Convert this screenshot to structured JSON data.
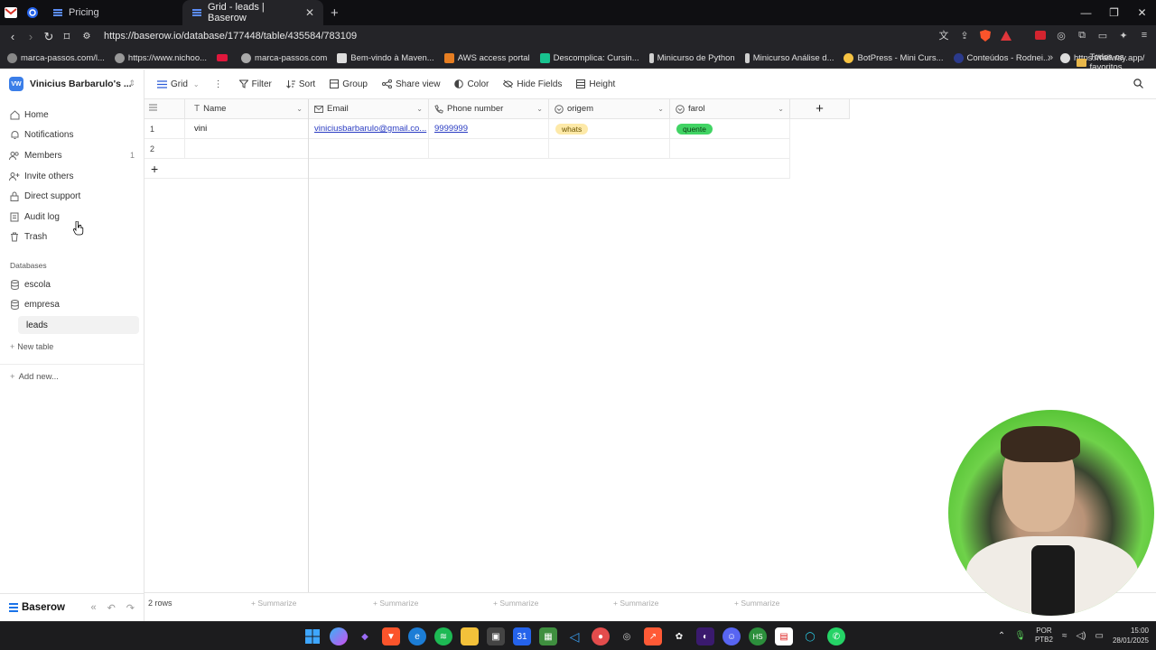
{
  "browser": {
    "tabs": [
      {
        "label": "Pricing"
      },
      {
        "label": "Grid - leads | Baserow"
      }
    ],
    "url": "https://baserow.io/database/177448/table/435584/783109",
    "bookmarks": [
      {
        "label": "marca-passos.com/l...",
        "color": "#888"
      },
      {
        "label": "https://www.nichoo...",
        "color": "#999"
      },
      {
        "label": "",
        "color": "#e0173c"
      },
      {
        "label": "marca-passos.com",
        "color": "#aaa"
      },
      {
        "label": "Bem-vindo à Maven...",
        "color": "#ddd"
      },
      {
        "label": "AWS access portal",
        "color": "#e67e22"
      },
      {
        "label": "Descomplica: Cursin...",
        "color": "#18c28f"
      },
      {
        "label": "Minicurso de Python",
        "color": "#cfcfcf"
      },
      {
        "label": "Minicurso Análise d...",
        "color": "#cfcfcf"
      },
      {
        "label": "BotPress - Mini Curs...",
        "color": "#f6c343"
      },
      {
        "label": "Conteúdos - Rodnei...",
        "color": "#2b3a8c"
      },
      {
        "label": "https://railway.app/",
        "color": "#ddd"
      }
    ],
    "favorites_label": "Todos os favoritos"
  },
  "workspace": {
    "name": "Vinicius Barbarulo's ...",
    "initials": "VW"
  },
  "sidebar": {
    "items": [
      {
        "label": "Home",
        "icon": "home-icon"
      },
      {
        "label": "Notifications",
        "icon": "bell-icon"
      },
      {
        "label": "Members",
        "icon": "users-icon",
        "count": "1"
      },
      {
        "label": "Invite others",
        "icon": "user-plus-icon"
      },
      {
        "label": "Direct support",
        "icon": "lock-icon"
      },
      {
        "label": "Audit log",
        "icon": "audit-icon"
      },
      {
        "label": "Trash",
        "icon": "trash-icon"
      }
    ],
    "databases_heading": "Databases",
    "databases": [
      {
        "label": "escola"
      },
      {
        "label": "empresa"
      }
    ],
    "active_table": "leads",
    "new_table": "New table",
    "add_new": "Add new..."
  },
  "brand": "Baserow",
  "toolbar": {
    "view": "Grid",
    "filter": "Filter",
    "sort": "Sort",
    "group": "Group",
    "share": "Share view",
    "color": "Color",
    "hide": "Hide Fields",
    "height": "Height"
  },
  "table": {
    "columns": [
      {
        "label": "Name",
        "icon": "text-icon"
      },
      {
        "label": "Email",
        "icon": "mail-icon"
      },
      {
        "label": "Phone number",
        "icon": "phone-icon"
      },
      {
        "label": "origem",
        "icon": "select-icon"
      },
      {
        "label": "farol",
        "icon": "select-icon"
      }
    ],
    "rows": [
      {
        "num": "1",
        "name": "vini",
        "email": "viniciusbarbarulo@gmail.co...",
        "phone": "9999999",
        "origem": "whats",
        "farol": "quente"
      },
      {
        "num": "2",
        "name": "",
        "email": "",
        "phone": "",
        "origem": "",
        "farol": ""
      }
    ],
    "row_count": "2 rows",
    "summarize": "Summarize"
  },
  "taskbar": {
    "lang": "POR",
    "layout": "PTB2",
    "time": "15:00",
    "date": "28/01/2025"
  }
}
